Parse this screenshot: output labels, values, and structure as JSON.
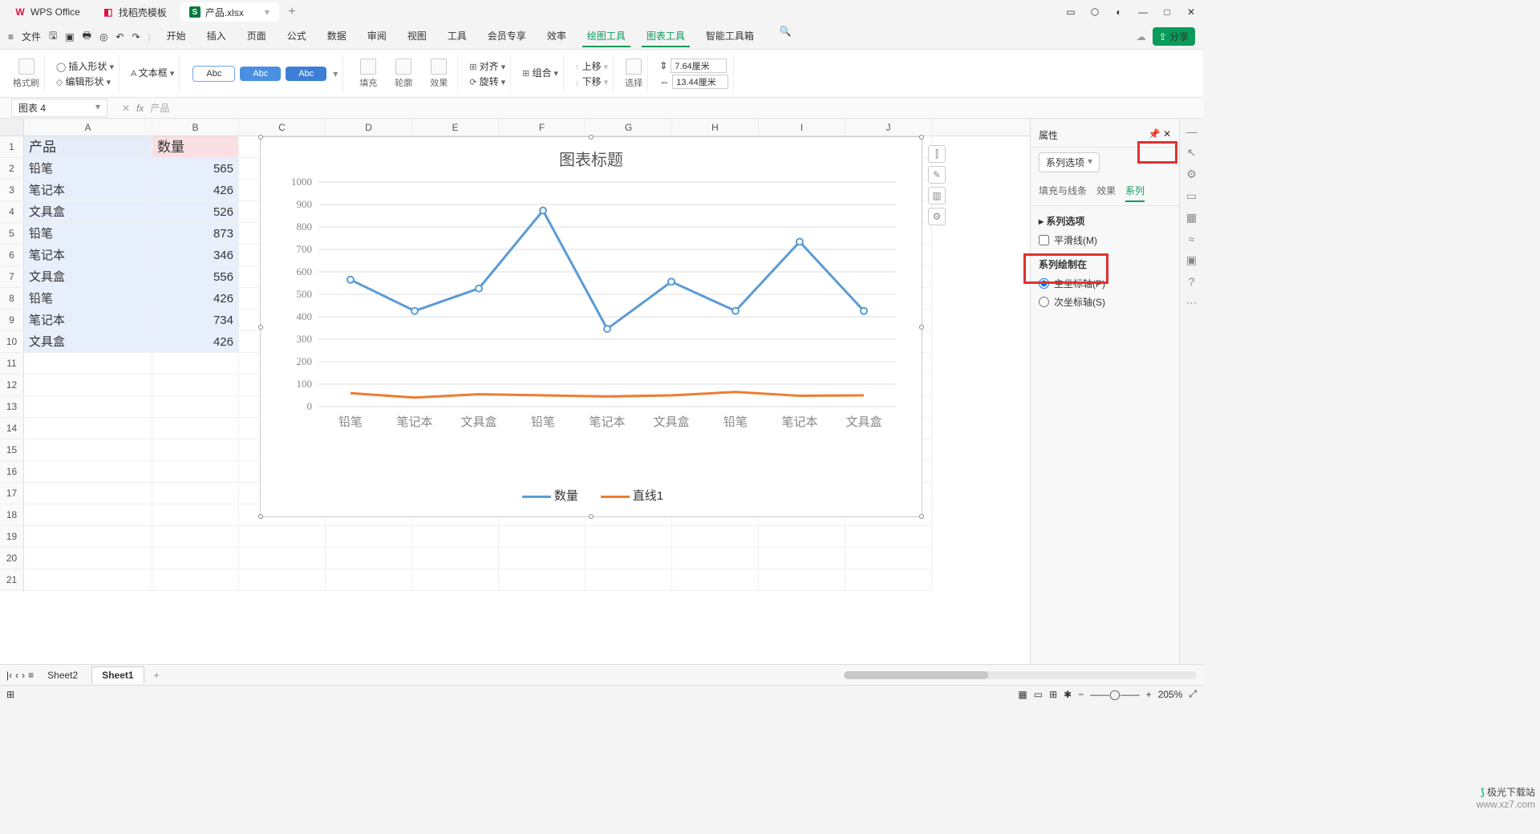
{
  "titlebar": {
    "tabs": [
      {
        "icon": "W",
        "label": "WPS Office"
      },
      {
        "icon": "◧",
        "label": "找稻壳模板"
      },
      {
        "icon": "S",
        "label": "产品.xlsx",
        "active": true
      }
    ],
    "newtab": "+"
  },
  "menubar": {
    "file": "文件",
    "items": [
      "开始",
      "插入",
      "页面",
      "公式",
      "数据",
      "审阅",
      "视图",
      "工具",
      "会员专享",
      "效率",
      "绘图工具",
      "图表工具",
      "智能工具箱"
    ],
    "active": [
      10,
      11
    ],
    "share": "分享"
  },
  "ribbon": {
    "format_brush": "格式刷",
    "insert_shape": "插入形状",
    "text_box": "文本框",
    "edit_shape": "编辑形状",
    "abc": "Abc",
    "fill": "填充",
    "outline": "轮廓",
    "effect": "效果",
    "align": "对齐",
    "group": "组合",
    "rotate": "旋转",
    "up": "上移",
    "down": "下移",
    "select": "选择",
    "dim1": "7.64厘米",
    "dim2": "13.44厘米"
  },
  "namebox": {
    "value": "图表 4",
    "fx_value": "产品",
    "fx": "fx"
  },
  "columns": [
    "A",
    "B",
    "C",
    "D",
    "E",
    "F",
    "G",
    "H",
    "I",
    "J"
  ],
  "rows": [
    " 1",
    " 2",
    " 3",
    " 4",
    " 5",
    " 6",
    " 7",
    " 8",
    " 9",
    "10",
    "11",
    "12",
    "13",
    "14",
    "15",
    "16",
    "17",
    "18",
    "19",
    "20",
    "21"
  ],
  "data": {
    "header": [
      "产品",
      "数量"
    ],
    "body": [
      [
        "铅笔",
        "565"
      ],
      [
        "笔记本",
        "426"
      ],
      [
        "文具盒",
        "526"
      ],
      [
        "铅笔",
        "873"
      ],
      [
        "笔记本",
        "346"
      ],
      [
        "文具盒",
        "556"
      ],
      [
        "铅笔",
        "426"
      ],
      [
        "笔记本",
        "734"
      ],
      [
        "文具盒",
        "426"
      ]
    ]
  },
  "chart_data": {
    "type": "line",
    "title": "图表标题",
    "categories": [
      "铅笔",
      "笔记本",
      "文具盒",
      "铅笔",
      "笔记本",
      "文具盒",
      "铅笔",
      "笔记本",
      "文具盒"
    ],
    "series": [
      {
        "name": "数量",
        "color": "#5b9bd5",
        "values": [
          565,
          426,
          526,
          873,
          346,
          556,
          426,
          734,
          426
        ]
      },
      {
        "name": "直线1",
        "color": "#ed7d31",
        "values": [
          60,
          40,
          55,
          50,
          45,
          50,
          65,
          48,
          50
        ]
      }
    ],
    "ylim": [
      0,
      1000
    ],
    "ystep": 100
  },
  "chart_tools": [
    "⫿",
    "✎",
    "▥",
    "⚙"
  ],
  "panel": {
    "title": "属性",
    "dropdown": "系列选项",
    "tabs": [
      "填充与线条",
      "效果",
      "系列"
    ],
    "active_tab": 2,
    "section1": "系列选项",
    "smooth": "平滑线(M)",
    "section2": "系列绘制在",
    "primary": "主坐标轴(P)",
    "secondary": "次坐标轴(S)"
  },
  "sheets": {
    "items": [
      "Sheet2",
      "Sheet1"
    ],
    "active": 1,
    "add": "+"
  },
  "status": {
    "zoom": "205%"
  },
  "watermark": {
    "a": "极光下载站",
    "b": "www.xz7.com"
  }
}
